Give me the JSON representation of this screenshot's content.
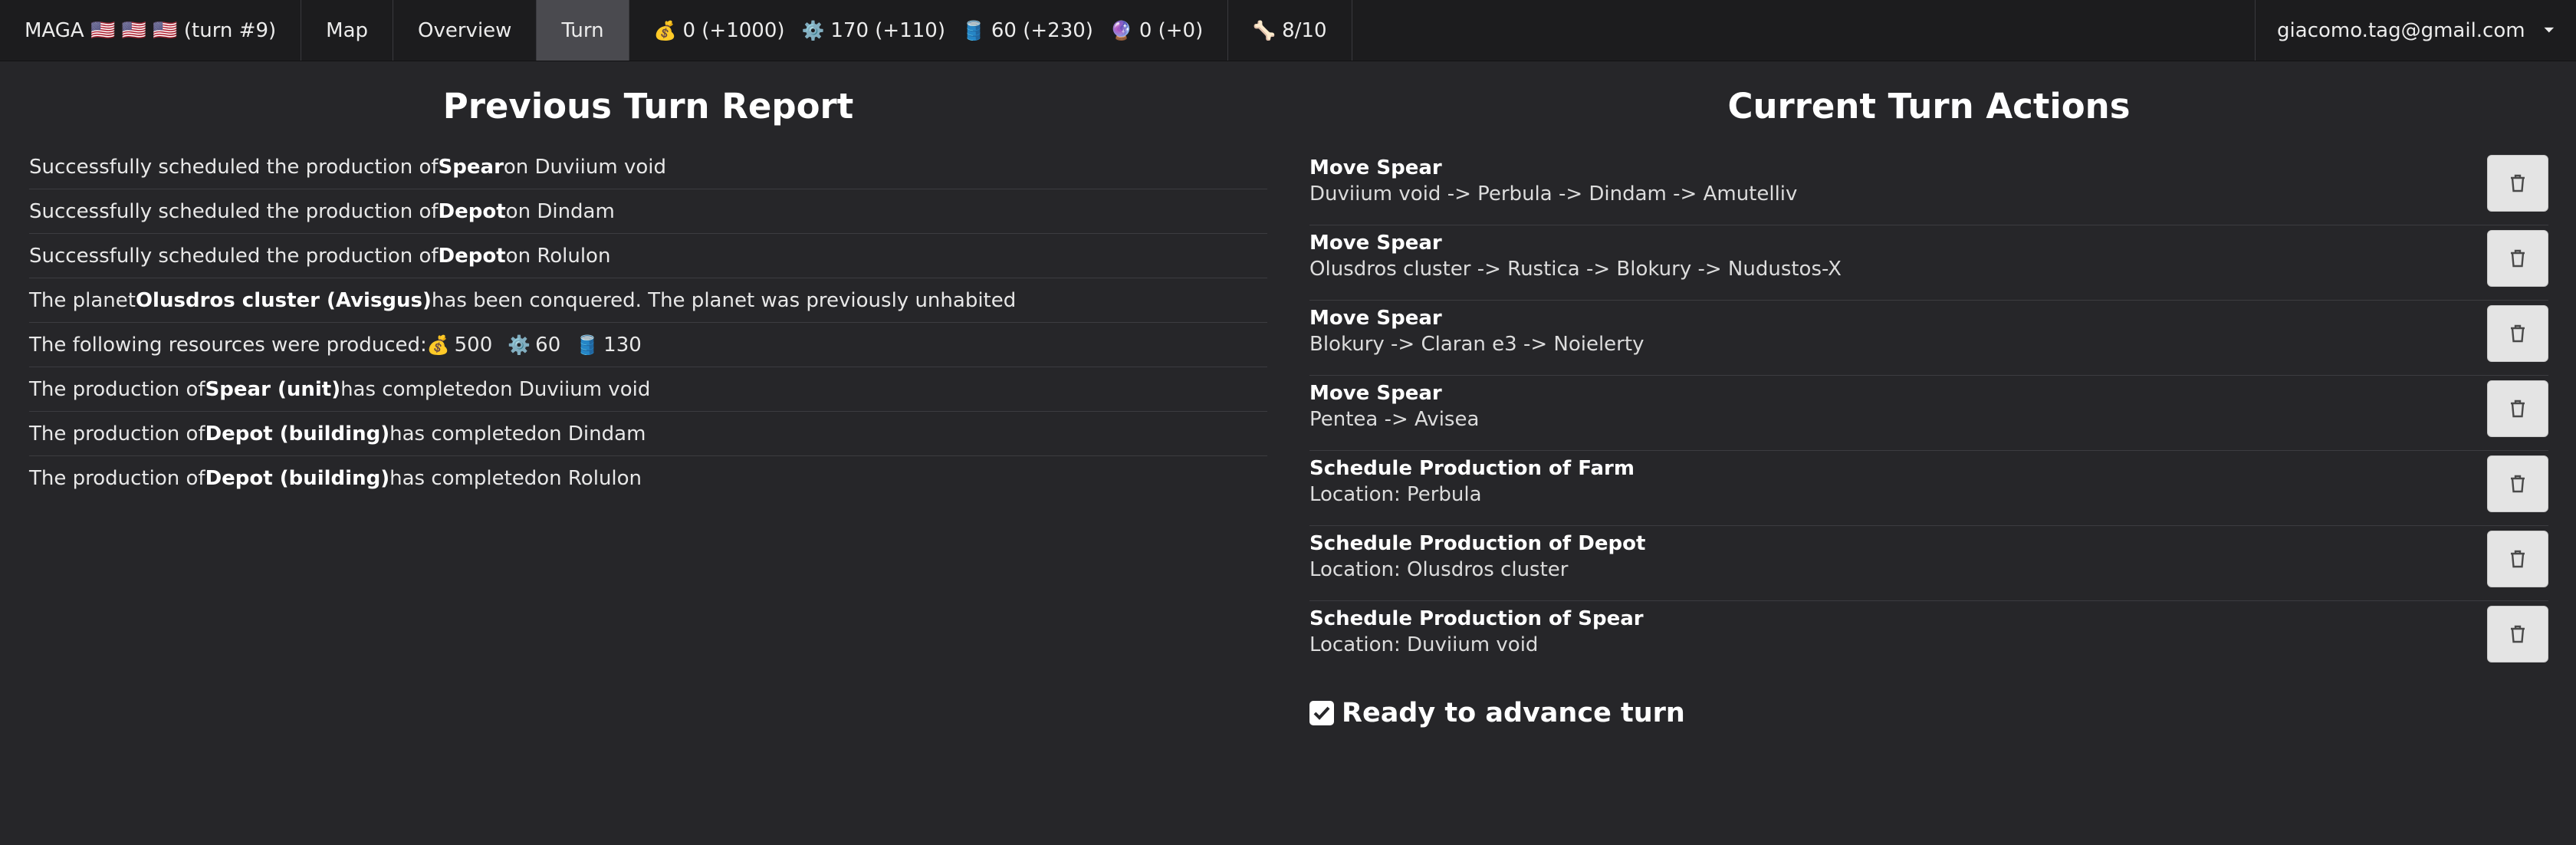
{
  "nav": {
    "game": "MAGA 🇺🇸 🇺🇸 🇺🇸 (turn #9)",
    "map": "Map",
    "overview": "Overview",
    "turn": "Turn",
    "resources": [
      {
        "icon": "💰",
        "value": "0 (+1000)"
      },
      {
        "icon": "⚙️",
        "value": "170 (+110)"
      },
      {
        "icon": "🛢️",
        "value": "60 (+230)"
      },
      {
        "icon": "🔮",
        "value": "0 (+0)"
      }
    ],
    "units_icon": "🦴",
    "units": "8/10",
    "user": "giacomo.tag@gmail.com",
    "user_caret": "⏷"
  },
  "report": {
    "title": "Previous Turn Report",
    "rows": [
      {
        "pre": "Successfully scheduled the production of ",
        "bold": "Spear",
        "post": " on Duviium void"
      },
      {
        "pre": "Successfully scheduled the production of ",
        "bold": "Depot",
        "post": " on Dindam"
      },
      {
        "pre": "Successfully scheduled the production of ",
        "bold": "Depot",
        "post": " on Rolulon"
      },
      {
        "pre": "The planet ",
        "bold": "Olusdros cluster (Avisgus)",
        "post": " has been conquered. The planet was previously unhabited"
      },
      {
        "pre": "The following resources were produced:",
        "res": [
          {
            "icon": "💰",
            "v": "500"
          },
          {
            "icon": "⚙️",
            "v": "60"
          },
          {
            "icon": "🛢️",
            "v": "130"
          }
        ]
      },
      {
        "pre": "The production of ",
        "bold": "Spear (unit)",
        "post": " has completedon Duviium void"
      },
      {
        "pre": "The production of ",
        "bold": "Depot (building)",
        "post": " has completedon Dindam"
      },
      {
        "pre": "The production of ",
        "bold": "Depot (building)",
        "post": " has completedon Rolulon"
      }
    ]
  },
  "actions": {
    "title": "Current Turn Actions",
    "items": [
      {
        "title": "Move Spear",
        "detail": "Duviium void -> Perbula -> Dindam -> Amutelliv"
      },
      {
        "title": "Move Spear",
        "detail": "Olusdros cluster -> Rustica -> Blokury -> Nudustos-X"
      },
      {
        "title": "Move Spear",
        "detail": "Blokury -> Claran e3 -> Noielerty"
      },
      {
        "title": "Move Spear",
        "detail": "Pentea -> Avisea"
      },
      {
        "title": "Schedule Production of Farm",
        "detail": "Location: Perbula"
      },
      {
        "title": "Schedule Production of Depot",
        "detail": "Location: Olusdros cluster"
      },
      {
        "title": "Schedule Production of Spear",
        "detail": "Location: Duviium void"
      }
    ],
    "ready": "Ready to advance turn"
  }
}
